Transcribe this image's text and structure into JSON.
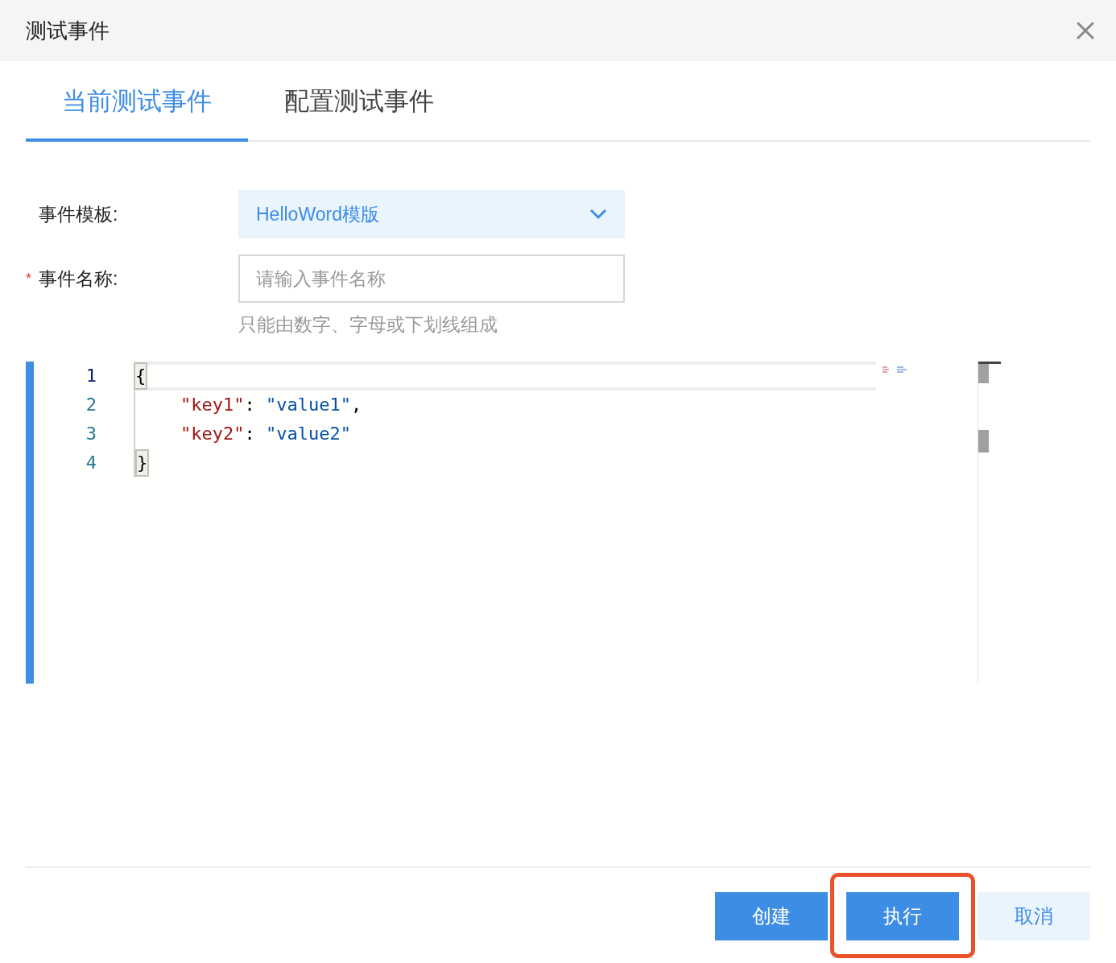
{
  "dialog": {
    "title": "测试事件"
  },
  "tabs": [
    {
      "label": "当前测试事件",
      "selected": true
    },
    {
      "label": "配置测试事件",
      "selected": false
    }
  ],
  "form": {
    "template": {
      "label": "事件模板:",
      "required": false,
      "value": "HelloWord模版"
    },
    "name": {
      "label": "事件名称:",
      "required": true,
      "required_mark": "*",
      "placeholder": "请输入事件名称",
      "hint": "只能由数字、字母或下划线组成"
    }
  },
  "editor": {
    "lines": [
      {
        "number": "1",
        "current": true,
        "indented": false,
        "tokens": [
          {
            "text": "{",
            "kind": "bracket",
            "matched": true
          }
        ]
      },
      {
        "number": "2",
        "current": false,
        "indented": true,
        "tokens": [
          {
            "text": "\"key1\"",
            "kind": "key"
          },
          {
            "text": ": ",
            "kind": "punct"
          },
          {
            "text": "\"value1\"",
            "kind": "string"
          },
          {
            "text": ",",
            "kind": "punct"
          }
        ]
      },
      {
        "number": "3",
        "current": false,
        "indented": true,
        "tokens": [
          {
            "text": "\"key2\"",
            "kind": "key"
          },
          {
            "text": ": ",
            "kind": "punct"
          },
          {
            "text": "\"value2\"",
            "kind": "string"
          }
        ]
      },
      {
        "number": "4",
        "current": false,
        "indented": false,
        "tokens": [
          {
            "text": "}",
            "kind": "bracket",
            "matched": true
          }
        ]
      }
    ]
  },
  "buttons": [
    {
      "label": "创建",
      "kind": "primary",
      "highlighted": false
    },
    {
      "label": "执行",
      "kind": "primary",
      "highlighted": true
    },
    {
      "label": "取消",
      "kind": "secondary",
      "highlighted": false
    }
  ]
}
